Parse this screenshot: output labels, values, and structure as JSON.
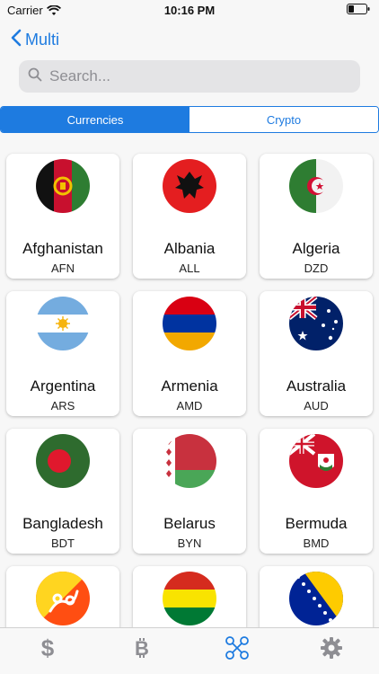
{
  "status_bar": {
    "carrier": "Carrier",
    "time": "10:16 PM"
  },
  "nav": {
    "back_label": "Multi"
  },
  "search": {
    "placeholder": "Search..."
  },
  "segments": [
    {
      "label": "Currencies",
      "active": true
    },
    {
      "label": "Crypto",
      "active": false
    }
  ],
  "countries": [
    {
      "name": "Afghanistan",
      "code": "AFN"
    },
    {
      "name": "Albania",
      "code": "ALL"
    },
    {
      "name": "Algeria",
      "code": "DZD"
    },
    {
      "name": "Argentina",
      "code": "ARS"
    },
    {
      "name": "Armenia",
      "code": "AMD"
    },
    {
      "name": "Australia",
      "code": "AUD"
    },
    {
      "name": "Bangladesh",
      "code": "BDT"
    },
    {
      "name": "Belarus",
      "code": "BYN"
    },
    {
      "name": "Bermuda",
      "code": "BMD"
    },
    {
      "name": "",
      "code": ""
    },
    {
      "name": "",
      "code": ""
    },
    {
      "name": "",
      "code": ""
    }
  ],
  "tabs": [
    {
      "icon": "dollar-icon",
      "active": false
    },
    {
      "icon": "bitcoin-icon",
      "active": false
    },
    {
      "icon": "exchange-icon",
      "active": true
    },
    {
      "icon": "gear-icon",
      "active": false
    }
  ],
  "colors": {
    "accent": "#1e7be0",
    "background": "#f7f7f7"
  }
}
